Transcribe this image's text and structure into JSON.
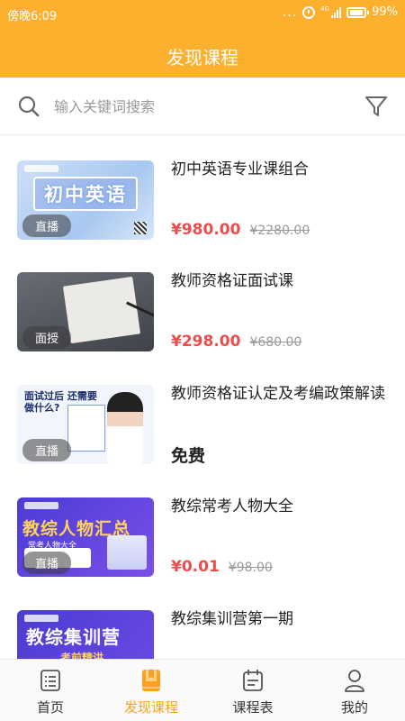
{
  "status_bar": {
    "time": "傍晚6:09",
    "dots": "...",
    "network": "4G",
    "battery": "99%"
  },
  "header": {
    "title": "发现课程"
  },
  "search": {
    "placeholder": "输入关键词搜索"
  },
  "courses": [
    {
      "title": "初中英语专业课组合",
      "badge": "直播",
      "thumb_text": "初中英语",
      "price": "¥980.00",
      "original_price": "¥2280.00"
    },
    {
      "title": "教师资格证面试课",
      "badge": "面授",
      "price": "¥298.00",
      "original_price": "¥680.00"
    },
    {
      "title": "教师资格证认定及考编政策解读",
      "badge": "直播",
      "thumb_text": "面试过后 还需要做什么?",
      "price_text": "免费"
    },
    {
      "title": "教综常考人物大全",
      "badge": "直播",
      "thumb_text": "教综人物汇总",
      "thumb_sub": "常考人物大全",
      "price": "¥0.01",
      "original_price": "¥98.00"
    },
    {
      "title": "教综集训营第一期",
      "thumb_text": "教综集训营",
      "thumb_sub": "考前精讲"
    }
  ],
  "tabs": [
    {
      "label": "首页",
      "icon": "home-list-icon",
      "active": false
    },
    {
      "label": "发现课程",
      "icon": "book-icon",
      "active": true
    },
    {
      "label": "课程表",
      "icon": "schedule-icon",
      "active": false
    },
    {
      "label": "我的",
      "icon": "user-icon",
      "active": false
    }
  ],
  "colors": {
    "header_bg": "#fcb02e",
    "price_red": "#ef4b4b",
    "active_tab": "#fca11d"
  }
}
